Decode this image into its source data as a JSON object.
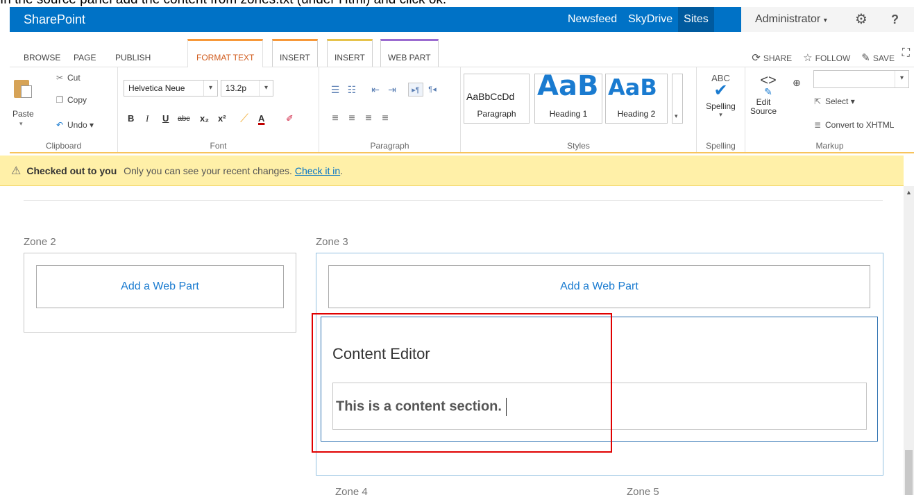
{
  "instruction": "In the source panel add the content from zones.txt (under Html) and click ok.",
  "suite": {
    "brand": "SharePoint",
    "links": [
      "Newsfeed",
      "SkyDrive",
      "Sites"
    ],
    "user": "Administrator",
    "help": "?"
  },
  "tabs": {
    "browse": "BROWSE",
    "page": "PAGE",
    "publish": "PUBLISH",
    "format_text": "FORMAT TEXT",
    "insert": "INSERT",
    "insert2": "INSERT",
    "web_part": "WEB PART"
  },
  "actions": {
    "share": "SHARE",
    "follow": "FOLLOW",
    "save": "SAVE"
  },
  "clipboard": {
    "paste": "Paste",
    "cut": "Cut",
    "copy": "Copy",
    "undo": "Undo",
    "caption": "Clipboard"
  },
  "font": {
    "family": "Helvetica Neue",
    "size": "13.2p",
    "bold": "B",
    "italic": "I",
    "underline": "U",
    "strike": "abc",
    "sub": "x₂",
    "sup": "x²",
    "color": "A",
    "caption": "Font"
  },
  "paragraph": {
    "caption": "Paragraph"
  },
  "styles": {
    "items": [
      {
        "sample": "AaBbCcDd",
        "label": "Paragraph"
      },
      {
        "sample": "AaB",
        "label": "Heading 1"
      },
      {
        "sample": "AaB",
        "label": "Heading 2"
      }
    ],
    "caption": "Styles"
  },
  "spelling": {
    "abc": "ABC",
    "label": "Spelling",
    "caption": "Spelling"
  },
  "markup": {
    "edit_source": "Edit Source",
    "select": "Select",
    "convert": "Convert to XHTML",
    "caption": "Markup",
    "select_value": ""
  },
  "status": {
    "bold": "Checked out to you",
    "text": "Only you can see your recent changes.",
    "link": "Check it in",
    "end": "."
  },
  "zones": {
    "zone2": "Zone 2",
    "zone3": "Zone 3",
    "zone4": "Zone 4",
    "zone5": "Zone 5",
    "add_web_part": "Add a Web Part"
  },
  "content_editor": {
    "title": "Content Editor",
    "body": "This is a content section."
  },
  "colors": {
    "suite_bar": "#0072c6",
    "accent_tab": "#d15b1c",
    "status_bg": "#fff0a8",
    "link": "#1a7bd0",
    "highlight": "#e00000"
  }
}
